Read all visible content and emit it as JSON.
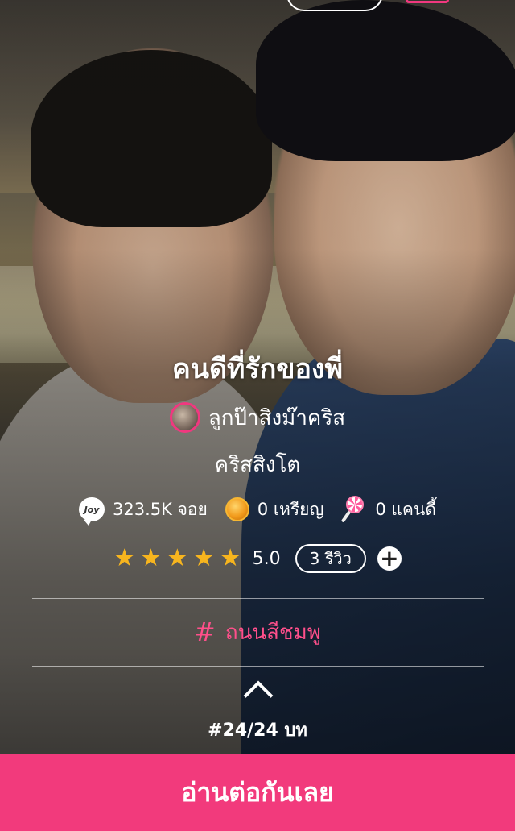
{
  "story": {
    "title": "คนดีที่รักของพี่",
    "author": "ลูกป๊าสิงม๊าคริส",
    "subtitle": "คริสสิงโต"
  },
  "stats": {
    "joy_icon_text": "Joy",
    "joy": "323.5K จอย",
    "coins": "0 เหรียญ",
    "candy": "0 แคนดี้"
  },
  "rating": {
    "stars": 5,
    "score": "5.0",
    "reviews": "3 รีวิว"
  },
  "tag": {
    "label": "ถนนสีชมพู",
    "color": "#ff4f8b"
  },
  "chapter": {
    "label": "#24/24 บท"
  },
  "cta": {
    "label": "อ่านต่อกันเลย",
    "color": "#f23a7c"
  },
  "icons": [
    "joy-icon",
    "coin-icon",
    "candy-icon",
    "star-icon",
    "plus-icon",
    "hash-icon",
    "chevron-up-icon"
  ]
}
